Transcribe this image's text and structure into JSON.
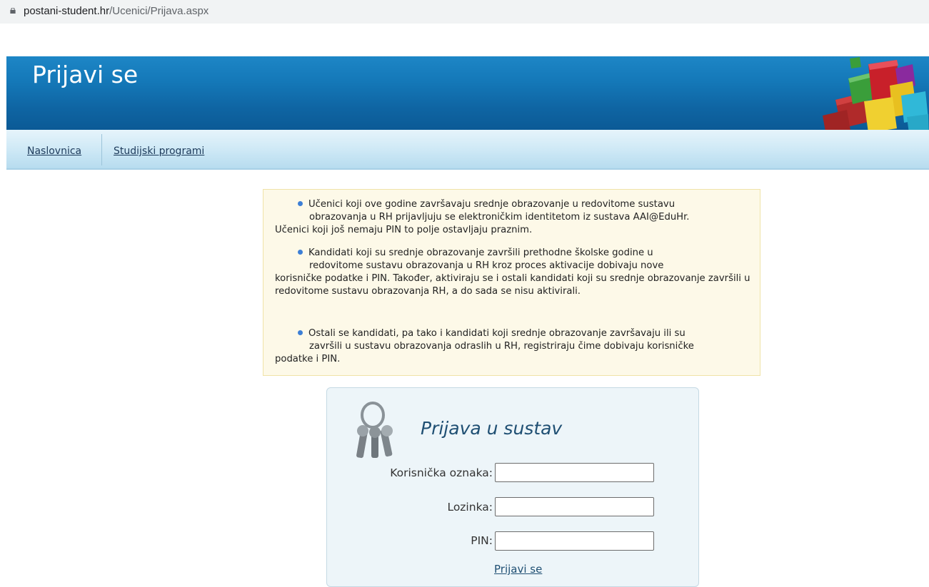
{
  "address_bar": {
    "domain": "postani-student.hr",
    "path": "/Ucenici/Prijava.aspx",
    "lock_icon": "lock-icon"
  },
  "header": {
    "title": "Prijavi se",
    "logo_icon": "colored-blocks-icon"
  },
  "nav": {
    "items": [
      "Naslovnica",
      "Studijski programi"
    ]
  },
  "info": {
    "bullet_color": "#3d7fd6",
    "items": [
      {
        "first": "Učenici koji ove godine završavaju srednje obrazovanje u redovitome sustavu",
        "second": "obrazovanja u RH prijavljuju se elektroničkim identitetom iz sustava AAI@EduHr.",
        "rest": "Učenici koji još nemaju PIN to polje ostavljaju praznim."
      },
      {
        "first": "Kandidati koji su srednje obrazovanje završili prethodne školske godine u",
        "second": "redovitome sustavu obrazovanja u RH kroz proces aktivacije dobivaju nove",
        "rest": "korisničke podatke i PIN. Također, aktiviraju se i ostali kandidati koji su srednje obrazovanje završili u redovitome sustavu obrazovanja RH, a do sada se nisu aktivirali."
      },
      {
        "first": "Ostali se kandidati, pa tako i kandidati koji srednje obrazovanje završavaju ili su",
        "second": "završili u sustavu obrazovanja odraslih u RH, registriraju čime dobivaju korisničke",
        "rest": "podatke i PIN."
      }
    ]
  },
  "login": {
    "title": "Prijava u sustav",
    "keys_icon": "keys-icon",
    "username_label": "Korisnička oznaka:",
    "password_label": "Lozinka:",
    "pin_label": "PIN:",
    "username_value": "",
    "password_value": "",
    "pin_value": "",
    "submit_label": "Prijavi se"
  }
}
